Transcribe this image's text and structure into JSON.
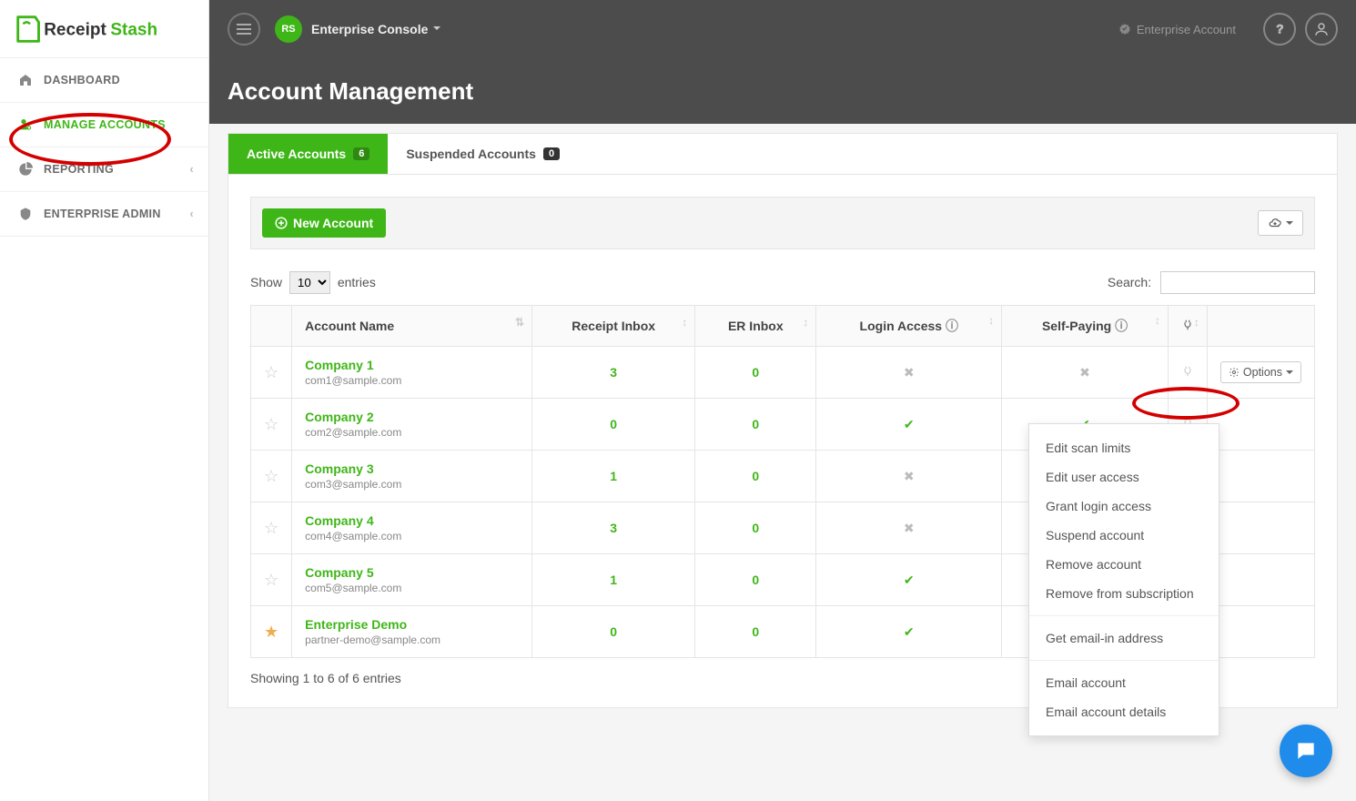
{
  "app_title": "Enterprise Console",
  "enterprise_label": "Enterprise Account",
  "page_title": "Account Management",
  "sidebar": {
    "items": [
      {
        "label": "DASHBOARD",
        "active": false,
        "expandable": false
      },
      {
        "label": "MANAGE ACCOUNTS",
        "active": true,
        "expandable": false
      },
      {
        "label": "REPORTING",
        "active": false,
        "expandable": true
      },
      {
        "label": "ENTERPRISE ADMIN",
        "active": false,
        "expandable": true
      }
    ]
  },
  "tabs": {
    "active": {
      "label": "Active Accounts",
      "count": "6"
    },
    "suspended": {
      "label": "Suspended Accounts",
      "count": "0"
    }
  },
  "toolbar": {
    "new_account": "New Account"
  },
  "table": {
    "show_left": "Show",
    "show_right": "entries",
    "show_value": "10",
    "search_label": "Search:",
    "headers": {
      "name": "Account Name",
      "receipt": "Receipt Inbox",
      "er": "ER Inbox",
      "login": "Login Access",
      "self": "Self-Paying"
    },
    "options_label": "Options",
    "rows": [
      {
        "fav": false,
        "name": "Company 1",
        "email": "com1@sample.com",
        "receipt": "3",
        "er": "0",
        "login": false,
        "self": false,
        "plug": false,
        "show_options": true
      },
      {
        "fav": false,
        "name": "Company 2",
        "email": "com2@sample.com",
        "receipt": "0",
        "er": "0",
        "login": true,
        "self": true,
        "plug": false,
        "show_options": false
      },
      {
        "fav": false,
        "name": "Company 3",
        "email": "com3@sample.com",
        "receipt": "1",
        "er": "0",
        "login": false,
        "self": false,
        "plug": false,
        "show_options": false
      },
      {
        "fav": false,
        "name": "Company 4",
        "email": "com4@sample.com",
        "receipt": "3",
        "er": "0",
        "login": false,
        "self": false,
        "plug": false,
        "show_options": false
      },
      {
        "fav": false,
        "name": "Company 5",
        "email": "com5@sample.com",
        "receipt": "1",
        "er": "0",
        "login": true,
        "self": false,
        "plug": false,
        "show_options": false
      },
      {
        "fav": true,
        "name": "Enterprise Demo",
        "email": "partner-demo@sample.com",
        "receipt": "0",
        "er": "0",
        "login": true,
        "self": false,
        "plug": false,
        "show_options": false
      }
    ],
    "info": "Showing 1 to 6 of 6 entries"
  },
  "dropdown": {
    "items": [
      "Edit scan limits",
      "Edit user access",
      "Grant login access",
      "Suspend account",
      "Remove account",
      "Remove from subscription",
      "",
      "Get email-in address",
      "",
      "Email account",
      "Email account details"
    ]
  }
}
